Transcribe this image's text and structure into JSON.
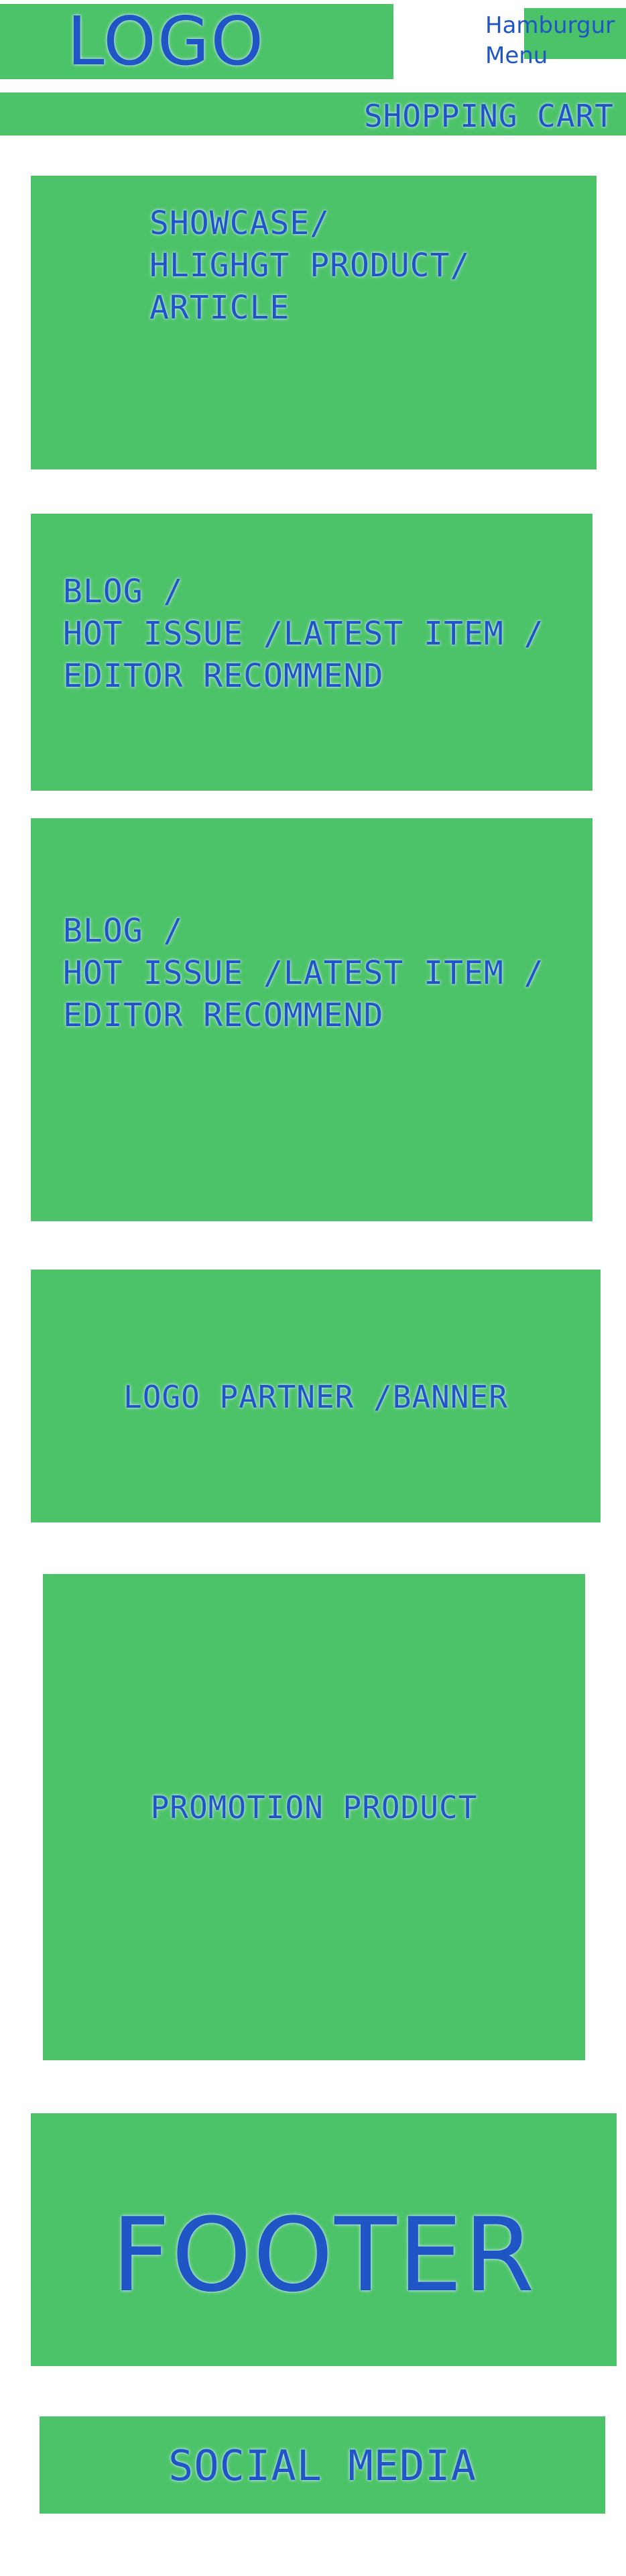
{
  "header": {
    "logo_text": "LOGO",
    "menu_label": "Hamburgur\nMenu",
    "cart_label": "SHOPPING CART"
  },
  "sections": {
    "showcase": "SHOWCASE/\nHLIGHGT PRODUCT/\nARTICLE",
    "blog_primary": "BLOG /\nHOT ISSUE /LATEST ITEM /\nEDITOR RECOMMEND",
    "blog_secondary": "BLOG /\nHOT ISSUE /LATEST ITEM /\nEDITOR RECOMMEND",
    "partner_banner": "LOGO PARTNER /BANNER",
    "promotion": "PROMOTION PRODUCT"
  },
  "footer": {
    "label": "FOOTER",
    "social_label": "SOCIAL MEDIA"
  },
  "colors": {
    "block_green": "#4cc368",
    "text_blue": "#1f55c4",
    "background": "#ffffff"
  }
}
